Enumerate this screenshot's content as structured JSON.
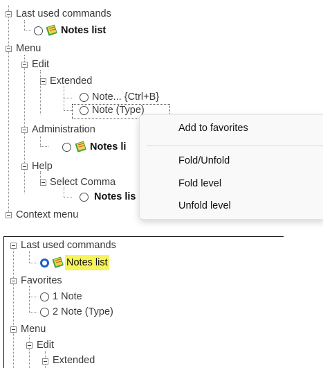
{
  "top": {
    "last_used": "Last used commands",
    "notes_list": "Notes list",
    "menu": "Menu",
    "edit": "Edit",
    "extended": "Extended",
    "note_ctrl": "Note... {Ctrl+B}",
    "note_type": "Note (Type)",
    "administration": "Administration",
    "notes_list_2": "Notes li",
    "help": "Help",
    "select_comma": "Select Comma",
    "notes_list_3": "Notes lis",
    "context_menu": "Context menu"
  },
  "context_popup": {
    "items": [
      "Add to favorites",
      "Fold/Unfold",
      "Fold level",
      "Unfold level"
    ]
  },
  "bottom": {
    "last_used": "Last used commands",
    "notes_list": "Notes list",
    "favorites": "Favorites",
    "fav_1": "1 Note",
    "fav_2": "2 Note (Type)",
    "menu": "Menu",
    "edit": "Edit",
    "extended": "Extended"
  },
  "icons": {
    "expander": "collapse-box-icon",
    "radio": "radio-icon",
    "notes": "notes-book-icon"
  },
  "colors": {
    "highlight": "#f7f35a",
    "radio_selected": "#1f5fc6"
  }
}
